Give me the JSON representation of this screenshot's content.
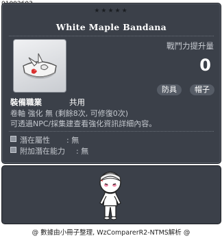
{
  "item_code": "01002603",
  "tooltip": {
    "stars": "★★★★★",
    "title": "White Maple Bandana",
    "icon": "white-bandana-icon",
    "power_label": "戰鬥力提升量",
    "power_value": "0",
    "tags": [
      "防具",
      "帽子"
    ],
    "job_label": "裝備職業",
    "job_value": "共用",
    "scroll_line": "卷軸 強化 無 (剩餘8次, 可修復0次)",
    "npc_line": "可透過NPC/採集建查看強化資訊詳細內容。",
    "potential_label": "潛在屬性",
    "potential_value": ":  無",
    "bonus_potential_label": "附加潛在能力",
    "bonus_potential_value": ":  無"
  },
  "preview": {
    "figure": "character-preview"
  },
  "footer": "@ 數據由小冊子整理, WzComparerR2-NTMS解析 @",
  "colors": {
    "panel_bg": "#3b4049",
    "text_main": "#ffffff",
    "text_sub": "#c4c8ce",
    "tag_bg": "#565c66"
  }
}
